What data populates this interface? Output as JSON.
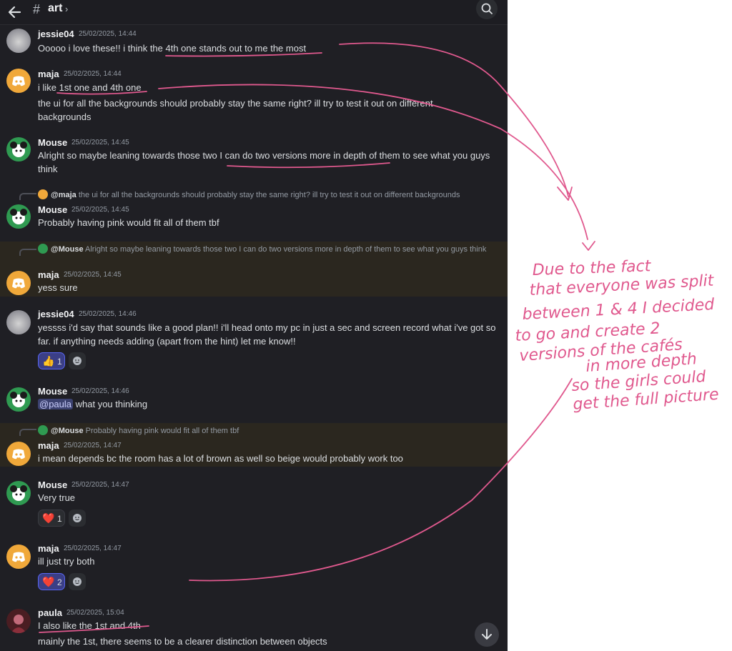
{
  "header": {
    "channel": "art",
    "hash": "#",
    "chevron": "›"
  },
  "messages": [
    {
      "user": "jessie04",
      "time": "25/02/2025, 14:44",
      "text_a": "Ooooo i love these!! i think the ",
      "text_b": "4th one stands out to me the most"
    },
    {
      "user": "maja",
      "time": "25/02/2025, 14:44",
      "line1_a": "i like ",
      "line1_b": "1st one and 4th one",
      "line2": "the ui for all the backgrounds should probably stay the same right? ill try to test it out on different backgrounds"
    },
    {
      "user": "Mouse",
      "time": "25/02/2025, 14:45",
      "text_a": "Alright so maybe leaning towards those two I ",
      "text_b": "can do two versions more in depth of",
      "text_c": " them to see what you guys think"
    },
    {
      "reply_name": "@maja",
      "reply_text": "the ui for all the backgrounds should probably stay the same right? ill try to test it out on different backgrounds",
      "user": "Mouse",
      "time": "25/02/2025, 14:45",
      "text": "Probably having pink would fit all of them tbf"
    },
    {
      "reply_name": "@Mouse",
      "reply_text": "Alright so maybe leaning towards those two I can do two versions more in depth of them to see what you guys think",
      "user": "maja",
      "time": "25/02/2025, 14:45",
      "text": "yess sure"
    },
    {
      "user": "jessie04",
      "time": "25/02/2025, 14:46",
      "text": "yessss i'd say that sounds like a good plan!! i'll head onto my pc in just a sec and screen record what i've got so far. if anything needs adding (apart from the hint) let me know!!",
      "reaction_emoji": "👍",
      "reaction_count": "1"
    },
    {
      "user": "Mouse",
      "time": "25/02/2025, 14:46",
      "mention": "@paula",
      "text": " what you thinking"
    },
    {
      "reply_name": "@Mouse",
      "reply_text": "Probably having pink would fit all of them tbf",
      "user": "maja",
      "time": "25/02/2025, 14:47",
      "text": "i mean depends bc the room has a lot of brown as well so beige would probably work too"
    },
    {
      "user": "Mouse",
      "time": "25/02/2025, 14:47",
      "text": "Very true",
      "reaction_emoji": "❤️",
      "reaction_count": "1"
    },
    {
      "user": "maja",
      "time": "25/02/2025, 14:47",
      "text": "ill just try both",
      "reaction_emoji": "❤️",
      "reaction_count": "2"
    },
    {
      "user": "paula",
      "time": "25/02/2025, 15:04",
      "line1_a": "I ",
      "line1_b": "also like the 1st and 4th",
      "line2": "mainly the 1st, there seems to be a clearer distinction between objects"
    }
  ],
  "annotation": {
    "lines": [
      "Due to the fact",
      "that everyone was split",
      "between 1 & 4 I decided",
      "to go and create 2",
      "versions of the cafés",
      "in more depth",
      "so the girls could",
      "get the full picture"
    ],
    "ink_color": "#e0598e"
  },
  "colors": {
    "app_bg": "#1f1f24",
    "highlight_bg": "#2b271f",
    "mention_bg": "#3c4270",
    "reaction_me": "#3b3f86"
  }
}
